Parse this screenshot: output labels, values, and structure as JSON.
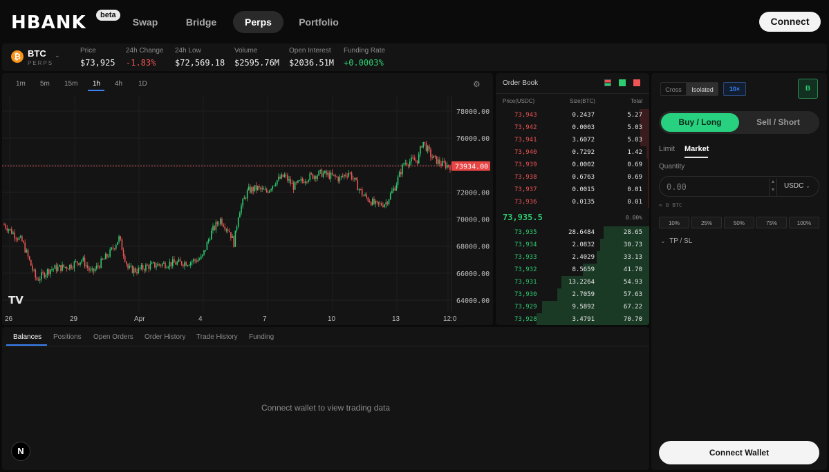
{
  "nav": {
    "logo": "HBANK",
    "beta": "beta",
    "links": [
      "Swap",
      "Bridge",
      "Perps",
      "Portfolio"
    ],
    "active": "Perps",
    "connect_label": "Connect"
  },
  "market": {
    "symbol": "BTC",
    "type": "PERPS",
    "icon": "bitcoin-icon",
    "stats": [
      {
        "label": "Price",
        "value": "$73,925",
        "color": "#f0f0f0"
      },
      {
        "label": "24h Change",
        "value": "-1.83%",
        "color": "#f05555"
      },
      {
        "label": "24h Low",
        "value": "$72,569.18",
        "color": "#f0f0f0"
      },
      {
        "label": "Volume",
        "value": "$2595.76M",
        "color": "#f0f0f0"
      },
      {
        "label": "Open Interest",
        "value": "$2036.51M",
        "color": "#f0f0f0"
      },
      {
        "label": "Funding Rate",
        "value": "+0.0003%",
        "color": "#2ecc71"
      }
    ]
  },
  "chart": {
    "timeframes": [
      "1m",
      "5m",
      "15m",
      "1h",
      "4h",
      "1D"
    ],
    "active_timeframe": "1h",
    "watermark": "TV"
  },
  "chart_data": {
    "type": "candlestick",
    "y_ticks": [
      "78000.00",
      "76000.00",
      "74000.00",
      "72000.00",
      "70000.00",
      "68000.00",
      "66000.00",
      "64000.00"
    ],
    "ylim": [
      63500,
      79000
    ],
    "x_ticks": [
      "26",
      "29",
      "Apr",
      "4",
      "7",
      "10",
      "13",
      "12:0"
    ],
    "current_price": 73934,
    "current_price_label": "73934.00",
    "close_path": [
      [
        0,
        69600
      ],
      [
        4,
        68300
      ],
      [
        7,
        65500
      ],
      [
        10,
        66300
      ],
      [
        14,
        66500
      ],
      [
        17,
        67000
      ],
      [
        19,
        66000
      ],
      [
        23,
        67500
      ],
      [
        25,
        68600
      ],
      [
        27,
        66300
      ],
      [
        29,
        66200
      ],
      [
        31,
        66500
      ],
      [
        35,
        66700
      ],
      [
        40,
        66800
      ],
      [
        43,
        67100
      ],
      [
        45,
        69000
      ],
      [
        47,
        70000
      ],
      [
        49,
        69100
      ],
      [
        50,
        68200
      ],
      [
        51,
        70500
      ],
      [
        53,
        72100
      ],
      [
        55,
        72300
      ],
      [
        57,
        72000
      ],
      [
        59,
        72800
      ],
      [
        61,
        73200
      ],
      [
        63,
        72400
      ],
      [
        66,
        73100
      ],
      [
        69,
        73400
      ],
      [
        73,
        73000
      ],
      [
        75,
        73500
      ],
      [
        78,
        71800
      ],
      [
        81,
        71000
      ],
      [
        83,
        71200
      ],
      [
        85,
        72400
      ],
      [
        87,
        74200
      ],
      [
        90,
        74400
      ],
      [
        91,
        75800
      ],
      [
        93,
        74600
      ],
      [
        95,
        74100
      ],
      [
        97,
        73934
      ]
    ]
  },
  "orderbook": {
    "title": "Order Book",
    "headers": [
      "Price(USDC)",
      "Size(BTC)",
      "Total"
    ],
    "asks": [
      {
        "price": "73,943",
        "size": "0.2437",
        "total": "5.27"
      },
      {
        "price": "73,942",
        "size": "0.0003",
        "total": "5.03"
      },
      {
        "price": "73,941",
        "size": "3.6072",
        "total": "5.03"
      },
      {
        "price": "73,940",
        "size": "0.7292",
        "total": "1.42"
      },
      {
        "price": "73,939",
        "size": "0.0002",
        "total": "0.69"
      },
      {
        "price": "73,938",
        "size": "0.6763",
        "total": "0.69"
      },
      {
        "price": "73,937",
        "size": "0.0015",
        "total": "0.01"
      },
      {
        "price": "73,936",
        "size": "0.0135",
        "total": "0.01"
      }
    ],
    "mid_price": "73,935.5",
    "spread": "0.00%",
    "bids": [
      {
        "price": "73,935",
        "size": "28.6484",
        "total": "28.65"
      },
      {
        "price": "73,934",
        "size": "2.0832",
        "total": "30.73"
      },
      {
        "price": "73,933",
        "size": "2.4029",
        "total": "33.13"
      },
      {
        "price": "73,932",
        "size": "8.5659",
        "total": "41.70"
      },
      {
        "price": "73,931",
        "size": "13.2264",
        "total": "54.93"
      },
      {
        "price": "73,930",
        "size": "2.7059",
        "total": "57.63"
      },
      {
        "price": "73,929",
        "size": "9.5892",
        "total": "67.22"
      },
      {
        "price": "73,928",
        "size": "3.4791",
        "total": "70.70"
      }
    ]
  },
  "bottom": {
    "tabs": [
      "Balances",
      "Positions",
      "Open Orders",
      "Order History",
      "Trade History",
      "Funding"
    ],
    "active": "Balances",
    "empty_message": "Connect wallet to view trading data",
    "badge": "N"
  },
  "trade": {
    "margin_modes": [
      "Cross",
      "Isolated"
    ],
    "active_margin": "Isolated",
    "leverage": "10×",
    "builder": "B",
    "buy_label": "Buy / Long",
    "sell_label": "Sell / Short",
    "order_types": [
      "Limit",
      "Market"
    ],
    "active_order_type": "Market",
    "quantity_label": "Quantity",
    "quantity_placeholder": "0.00",
    "quantity_unit": "USDC",
    "btc_equiv": "≈ 0 BTC",
    "percents": [
      "10%",
      "25%",
      "50%",
      "75%",
      "100%"
    ],
    "tpsl_label": "TP / SL",
    "connect_wallet_label": "Connect Wallet"
  },
  "colors": {
    "up": "#2ecc71",
    "down": "#f05555",
    "accent": "#3b82f6",
    "buy": "#27d17f",
    "background": "#0b0b0b",
    "panel": "#141414"
  }
}
